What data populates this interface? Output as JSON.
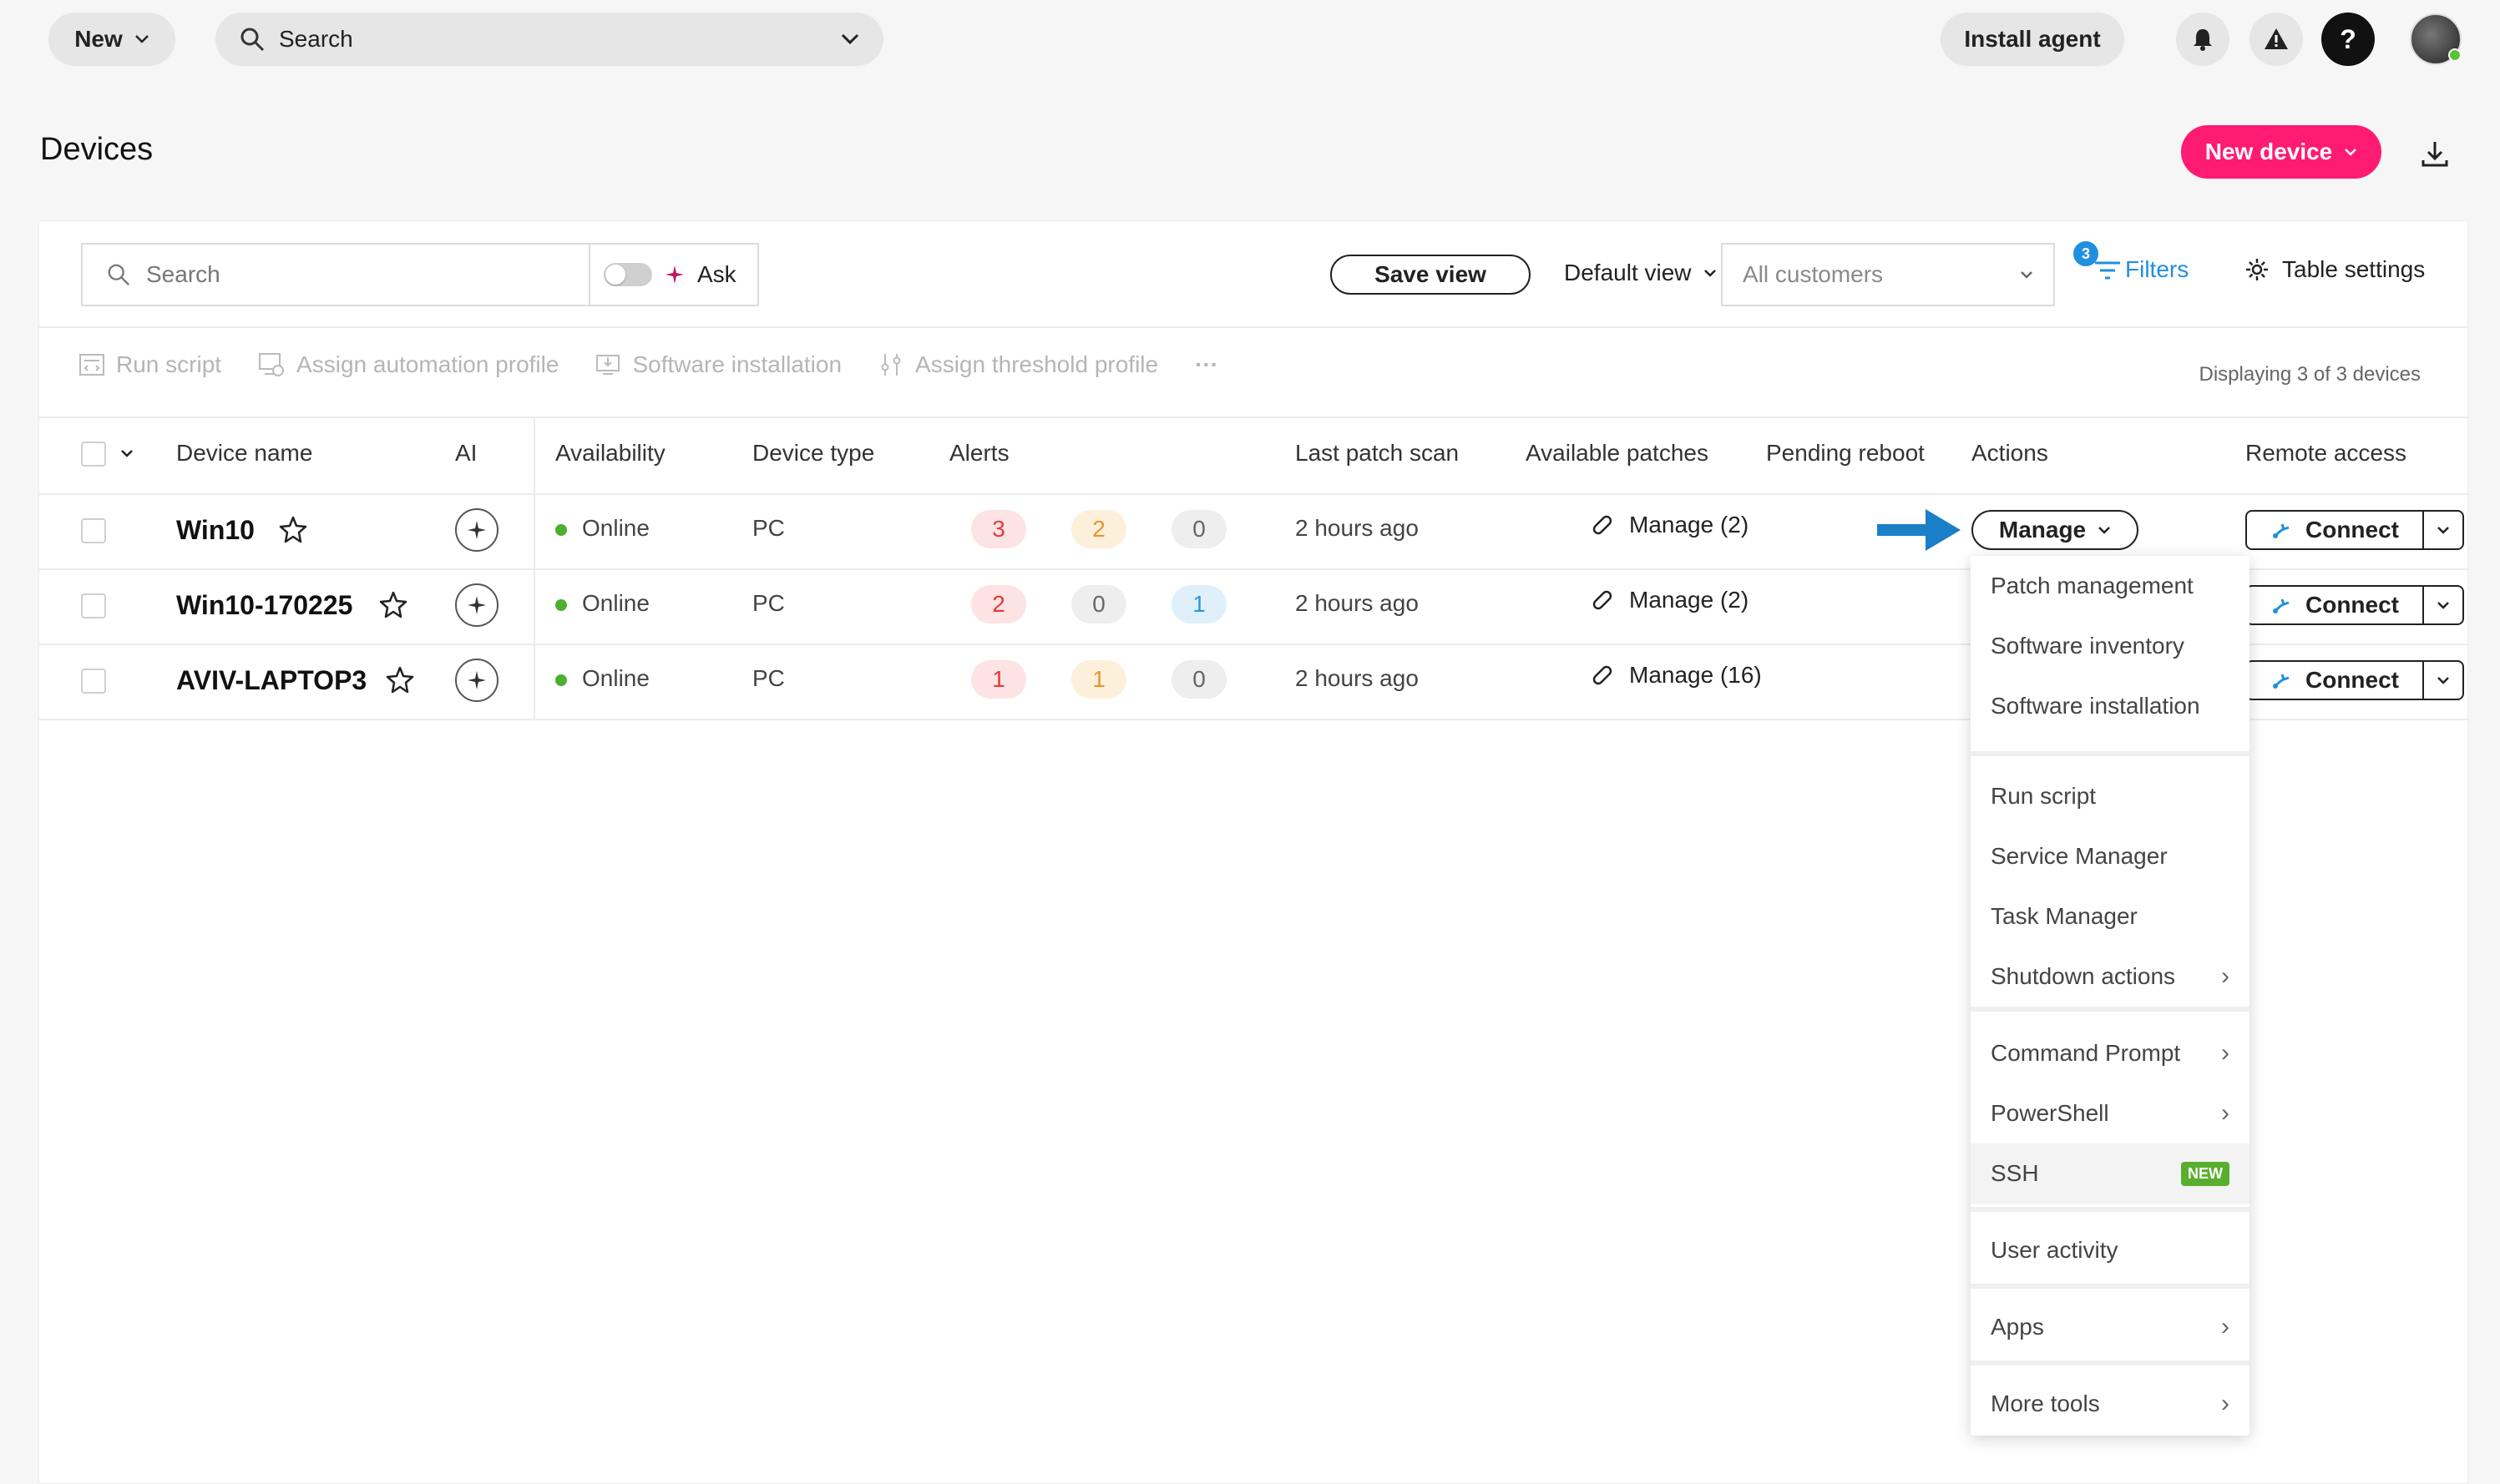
{
  "topbar": {
    "new_label": "New",
    "search_label": "Search",
    "install_agent_label": "Install agent",
    "help_label": "?"
  },
  "page": {
    "title": "Devices",
    "new_device_label": "New device"
  },
  "toolbar": {
    "search_placeholder": "Search",
    "ask_label": "Ask",
    "save_view_label": "Save view",
    "default_view_label": "Default view",
    "customers_placeholder": "All customers",
    "filters_label": "Filters",
    "filters_count": "3",
    "table_settings_label": "Table settings"
  },
  "bulk_actions": {
    "run_script": "Run script",
    "assign_automation_profile": "Assign automation profile",
    "software_installation": "Software installation",
    "assign_threshold_profile": "Assign threshold profile",
    "more": "···",
    "displaying": "Displaying 3 of 3 devices"
  },
  "table": {
    "headers": {
      "device_name": "Device name",
      "ai": "AI",
      "availability": "Availability",
      "device_type": "Device type",
      "alerts": "Alerts",
      "last_patch_scan": "Last patch scan",
      "available_patches": "Available patches",
      "pending_reboot": "Pending reboot",
      "actions": "Actions",
      "remote_access": "Remote access"
    },
    "rows": [
      {
        "name": "Win10",
        "availability": "Online",
        "type": "PC",
        "alerts": [
          "3",
          "2",
          "0"
        ],
        "last_scan": "2 hours ago",
        "patches": "Manage (2)"
      },
      {
        "name": "Win10-170225",
        "availability": "Online",
        "type": "PC",
        "alerts": [
          "2",
          "0",
          "1"
        ],
        "last_scan": "2 hours ago",
        "patches": "Manage (2)"
      },
      {
        "name": "AVIV-LAPTOP3",
        "availability": "Online",
        "type": "PC",
        "alerts": [
          "1",
          "1",
          "0"
        ],
        "last_scan": "2 hours ago",
        "patches": "Manage (16)"
      }
    ],
    "manage_label": "Manage",
    "connect_label": "Connect"
  },
  "menu": {
    "items": [
      "Patch management",
      "Software inventory",
      "Software installation",
      "Run script",
      "Service Manager",
      "Task Manager",
      "Shutdown actions",
      "Command Prompt",
      "PowerShell",
      "SSH",
      "User activity",
      "Apps",
      "More tools"
    ],
    "new_badge": "NEW"
  },
  "colors": {
    "brand_pink": "#ff1a72",
    "link_blue": "#1f8fe0",
    "online_green": "#4caf2f",
    "annotation_arrow": "#1a7fc7"
  }
}
